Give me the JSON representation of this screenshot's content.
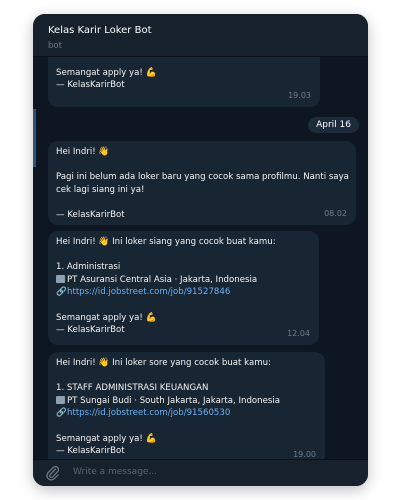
{
  "header": {
    "title": "Kelas Karir Loker Bot",
    "subtitle": "bot"
  },
  "messages": {
    "m0": {
      "line1": "Semangat apply ya!",
      "line2": "— KelasKarirBot",
      "time": "19.03"
    },
    "date_pill": "April 16",
    "m1": {
      "greeting": "Hei Indri!",
      "body1": "Pagi ini belum ada loker baru yang cocok sama profilmu. Nanti saya",
      "body2": "cek lagi siang ini ya!",
      "sign": "— KelasKarirBot",
      "time": "08.02"
    },
    "m2": {
      "greeting": "Hei Indri!",
      "intro": "Ini loker siang yang cocok buat kamu:",
      "job_title": "1. Administrasi",
      "company": "PT Asuransi Central Asia · Jakarta, Indonesia",
      "url": "https://id.jobstreet.com/job/91527846",
      "closing": "Semangat apply ya!",
      "sign": "— KelasKarirBot",
      "time": "12.04"
    },
    "m3": {
      "greeting": "Hei Indri!",
      "intro": "Ini loker sore yang cocok buat kamu:",
      "job_title": "1. STAFF ADMINISTRASI KEUANGAN",
      "company": "PT Sungai Budi · South Jakarta, Jakarta, Indonesia",
      "url": "https://id.jobstreet.com/job/91560530",
      "closing": "Semangat apply ya!",
      "sign": "— KelasKarirBot",
      "time": "19.00"
    }
  },
  "input": {
    "placeholder": "Write a message..."
  },
  "icons": {
    "wave": "👋",
    "muscle": "💪",
    "card": "company-card-icon",
    "link": "🔗",
    "attach": "paperclip-icon"
  },
  "colors": {
    "background": "#0e1621",
    "bubble": "#182533",
    "link": "#6ab3f3",
    "header": "#17212b"
  }
}
